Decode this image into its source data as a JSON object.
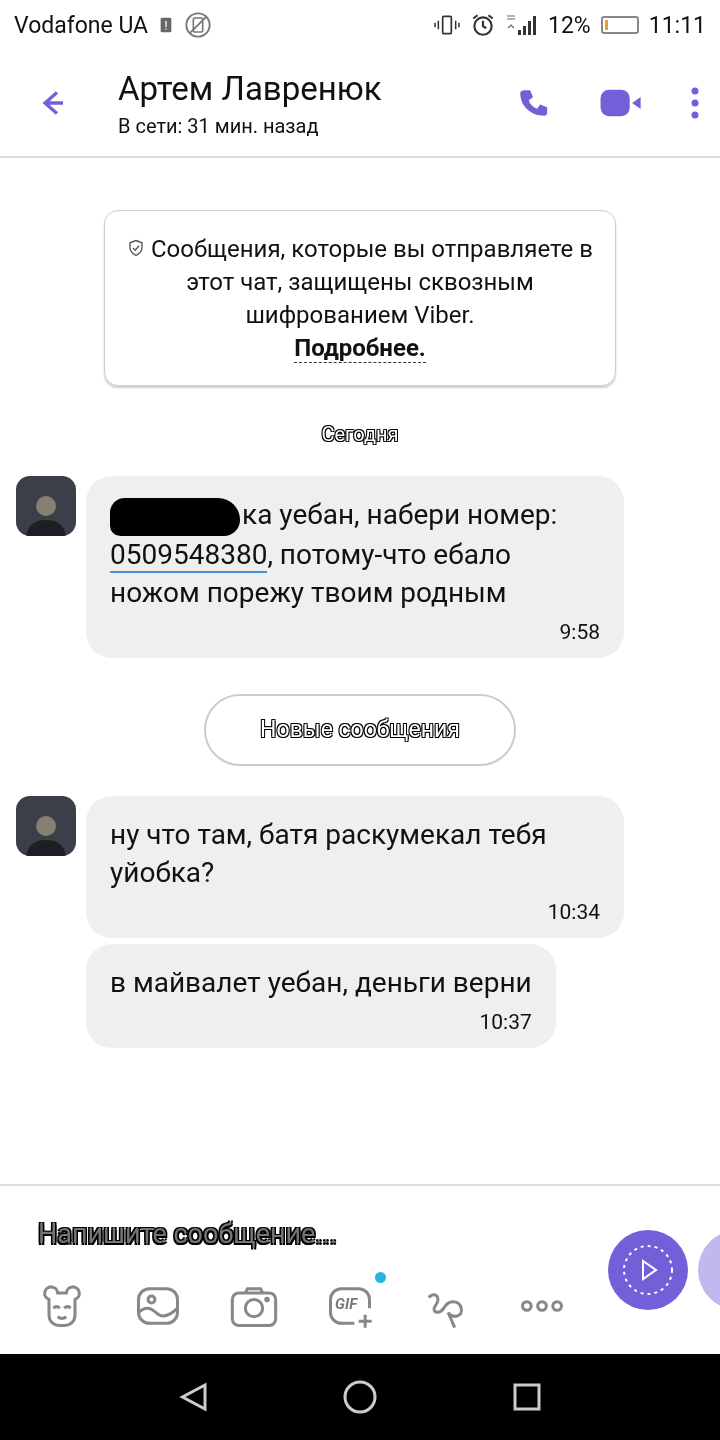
{
  "status_bar": {
    "carrier": "Vodafone UA",
    "battery_text": "12%",
    "time": "11:11"
  },
  "header": {
    "title": "Артем Лавренюк",
    "subtitle": "В сети: 31 мин. назад"
  },
  "encryption_notice": {
    "text": "Сообщения, которые вы отправляете в этот чат, защищены сквозным шифрованием Viber.",
    "link": "Подробнее."
  },
  "items": [
    {
      "kind": "date",
      "text": "Сегодня"
    },
    {
      "kind": "message",
      "avatar": true,
      "redacted": true,
      "text_before": "ка уебан, набери номер: ",
      "link": "0509548380",
      "text_after": ", потому-что ебало ножом порежу твоим родным",
      "time": "9:58"
    },
    {
      "kind": "divider",
      "text": "Новые сообщения"
    },
    {
      "kind": "message",
      "avatar": true,
      "redacted": false,
      "text_before": "ну что там, батя раскумекал тебя уйобка?",
      "time": "10:34"
    },
    {
      "kind": "message",
      "avatar": false,
      "redacted": false,
      "text_before": "в майвалет уебан, деньги верни",
      "time": "10:37"
    }
  ],
  "composer": {
    "placeholder": "Напишите сообщение...",
    "gif_label": "GIF",
    "gif_new": true
  }
}
